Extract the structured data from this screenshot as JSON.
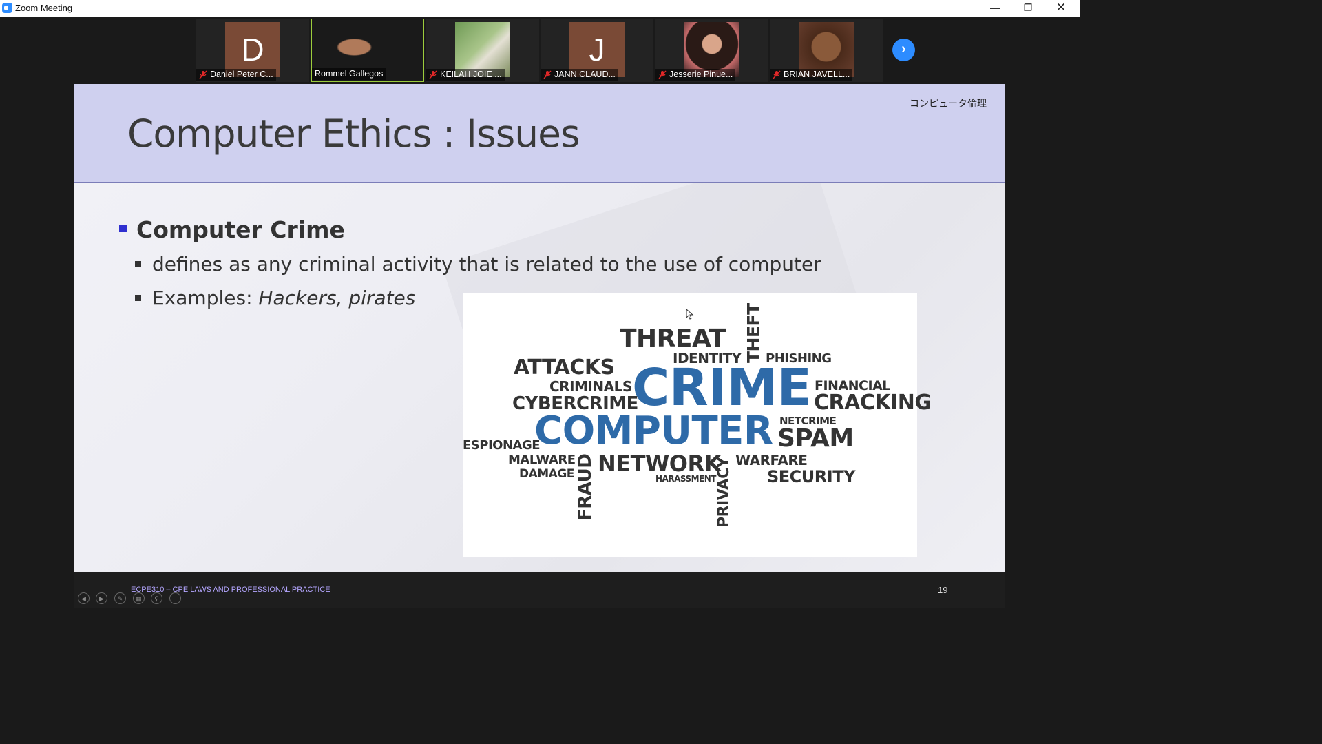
{
  "window": {
    "title": "Zoom Meeting"
  },
  "participants": [
    {
      "name": "Daniel Peter C...",
      "initial": "D",
      "muted": true
    },
    {
      "name": "Rommel Gallegos",
      "muted": false,
      "speaking": true
    },
    {
      "name": "KEILAH JOIE ...",
      "muted": true
    },
    {
      "name": "JANN CLAUD...",
      "initial": "J",
      "muted": true
    },
    {
      "name": "Jesserie Pinue...",
      "muted": true
    },
    {
      "name": "BRIAN JAVELL...",
      "muted": true
    }
  ],
  "slide": {
    "title": "Computer Ethics : Issues",
    "jp_label": "コンピュータ倫理",
    "bullet": "Computer Crime",
    "sub1": "defines as any criminal activity that is related to the use of computer",
    "sub2_prefix": "Examples: ",
    "sub2_italic": "Hackers, pirates",
    "word_cloud": {
      "threat": "THREAT",
      "theft": "THEFT",
      "identity": "IDENTITY",
      "phishing": "PHISHING",
      "attacks": "ATTACKS",
      "criminals": "CRIMINALS",
      "crime": "CRIME",
      "financial": "FINANCIAL",
      "cybercrime": "CYBERCRIME",
      "cracking": "CRACKING",
      "computer": "COMPUTER",
      "netcrime": "NETCRIME",
      "spam": "SPAM",
      "espionage": "ESPIONAGE",
      "malware": "MALWARE",
      "damage": "DAMAGE",
      "fraud": "FRAUD",
      "network": "NETWORK",
      "privacy": "PRIVACY",
      "warfare": "WARFARE",
      "harassment": "HARASSMENT",
      "security": "SECURITY"
    },
    "footer": "ECPE310 – CPE LAWS AND PROFESSIONAL PRACTICE",
    "page": "19"
  },
  "colors": {
    "zoom_blue": "#2d8cff",
    "header_band": "#cfd0ef",
    "cloud_blue": "#2e6aa8",
    "bullet_blue": "#3030d0"
  }
}
